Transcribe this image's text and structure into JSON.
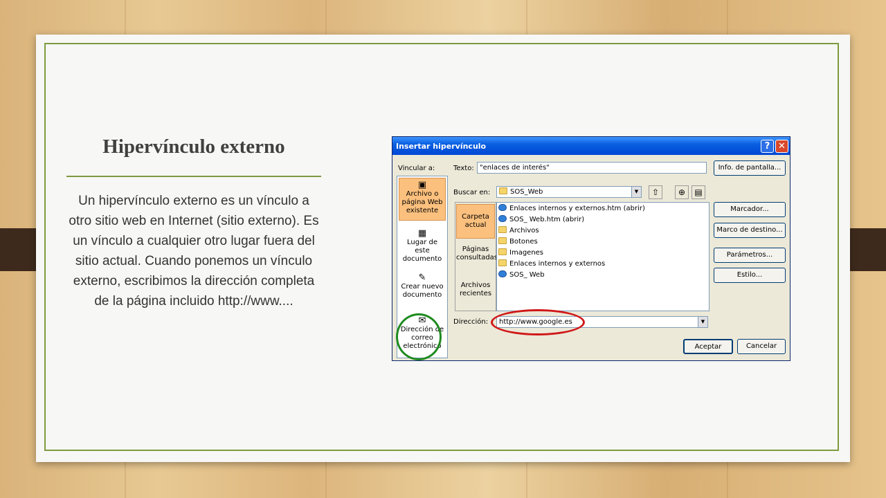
{
  "slide": {
    "title": "Hipervínculo externo",
    "body": "Un hipervínculo externo es un vínculo a otro sitio web en Internet (sitio externo). Es un vínculo a cualquier otro lugar fuera del sitio actual. Cuando ponemos un vínculo externo, escribimos la dirección completa de la página incluido http://www...."
  },
  "dialog": {
    "title": "Insertar hipervínculo",
    "help_label": "?",
    "close_label": "✕",
    "link_to_label": "Vincular a:",
    "text_label": "Texto:",
    "text_value": "\"enlaces de interés\"",
    "screen_info_button": "Info. de pantalla...",
    "look_in_label": "Buscar en:",
    "look_in_value": "SOS_Web",
    "address_label": "Dirección:",
    "address_value": "http://www.google.es",
    "link_targets": [
      {
        "label": "Archivo o página Web existente",
        "icon": "web-page-icon",
        "selected": true
      },
      {
        "label": "Lugar de este documento",
        "icon": "document-place-icon",
        "selected": false
      },
      {
        "label": "Crear nuevo documento",
        "icon": "new-document-icon",
        "selected": false
      },
      {
        "label": "Dirección de correo electrónico",
        "icon": "email-icon",
        "selected": false
      }
    ],
    "views": [
      {
        "label": "Carpeta actual",
        "selected": true
      },
      {
        "label": "Páginas consultadas",
        "selected": false
      },
      {
        "label": "Archivos recientes",
        "selected": false
      }
    ],
    "files": [
      {
        "name": "Enlaces internos y externos.htm (abrir)",
        "type": "web"
      },
      {
        "name": "SOS_ Web.htm (abrir)",
        "type": "web"
      },
      {
        "name": "Archivos",
        "type": "folder"
      },
      {
        "name": "Botones",
        "type": "folder"
      },
      {
        "name": "Imagenes",
        "type": "folder"
      },
      {
        "name": "Enlaces internos y externos",
        "type": "folder"
      },
      {
        "name": "SOS_ Web",
        "type": "web"
      }
    ],
    "side_buttons": [
      "Marcador...",
      "Marco de destino...",
      "Parámetros...",
      "Estilo..."
    ],
    "ok_button": "Aceptar",
    "cancel_button": "Cancelar"
  },
  "colors": {
    "accent_green": "#7d9a3e",
    "annotation_red": "#d01818",
    "annotation_green": "#1f8a1f",
    "selection_orange": "#fbc07d"
  }
}
